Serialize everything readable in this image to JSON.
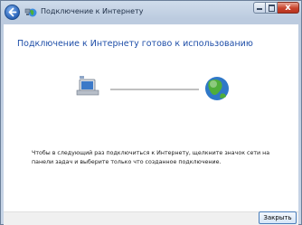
{
  "window": {
    "title": "Подключение к Интернету",
    "close_glyph": "x"
  },
  "main": {
    "heading": "Подключение к Интернету готово к использованию",
    "note": "Чтобы в следующий раз подключиться к Интернету, щелкните значок сети на панели задач и выберите только что созданное подключение."
  },
  "footer": {
    "close_label": "Закрыть"
  },
  "colors": {
    "heading": "#1e4ea8",
    "close_button": "#c8432b"
  },
  "icons": [
    "back-arrow-icon",
    "network-icon",
    "computer-icon",
    "globe-icon"
  ]
}
